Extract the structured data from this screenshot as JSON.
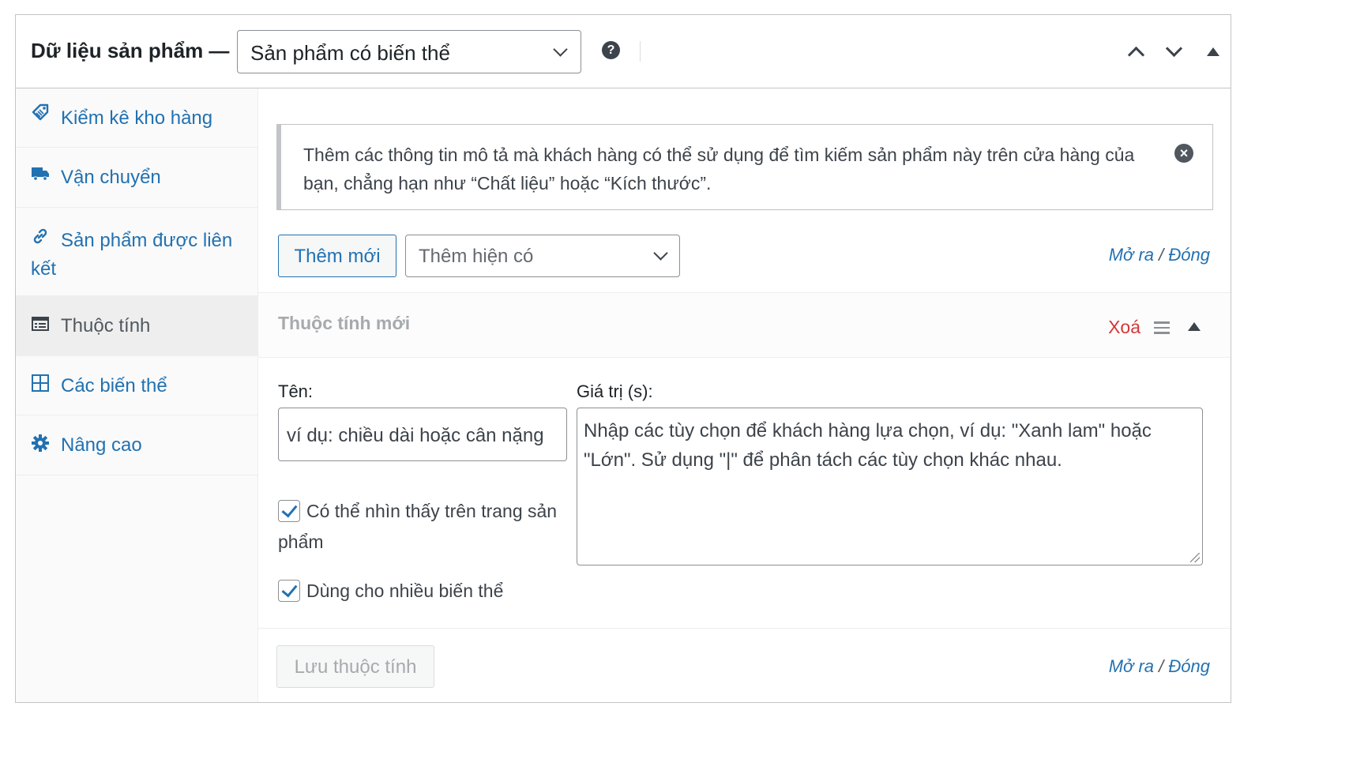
{
  "header": {
    "title": "Dữ liệu sản phẩm —",
    "product_type": "Sản phẩm có biến thể",
    "help": "?"
  },
  "sidebar": {
    "items": [
      {
        "label": "Kiểm kê kho hàng",
        "icon": "tag-icon"
      },
      {
        "label": "Vận chuyển",
        "icon": "truck-icon"
      },
      {
        "label": "Sản phẩm được liên kết",
        "icon": "link-icon"
      },
      {
        "label": "Thuộc tính",
        "icon": "list-table-icon",
        "active": true
      },
      {
        "label": "Các biến thể",
        "icon": "grid-icon"
      },
      {
        "label": "Nâng cao",
        "icon": "gear-icon"
      }
    ]
  },
  "notice": {
    "text": "Thêm các thông tin mô tả mà khách hàng có thể sử dụng để tìm kiếm sản phẩm này trên cửa hàng của bạn, chẳng hạn như “Chất liệu” hoặc “Kích thước”."
  },
  "toolbar": {
    "add_new": "Thêm mới",
    "add_existing_placeholder": "Thêm hiện có",
    "expand": "Mở ra",
    "separator": "/",
    "close": "Đóng"
  },
  "attribute": {
    "title": "Thuộc tính mới",
    "remove": "Xoá",
    "name_label": "Tên:",
    "name_placeholder": "ví dụ: chiều dài hoặc cân nặng",
    "values_label": "Giá trị (s):",
    "values_placeholder": "Nhập các tùy chọn để khách hàng lựa chọn, ví dụ: \"Xanh lam\" hoặc \"Lớn\". Sử dụng \"|\" để phân tách các tùy chọn khác nhau.",
    "visible_label": "Có thể nhìn thấy trên trang sản phẩm",
    "visible_checked": true,
    "variations_label": "Dùng cho nhiều biến thể",
    "variations_checked": true
  },
  "footer": {
    "save": "Lưu thuộc tính",
    "expand": "Mở ra",
    "separator": "/",
    "close": "Đóng"
  },
  "colors": {
    "link": "#2271b1",
    "danger": "#d63638",
    "border": "#c3c4c7",
    "text": "#1d2327"
  }
}
